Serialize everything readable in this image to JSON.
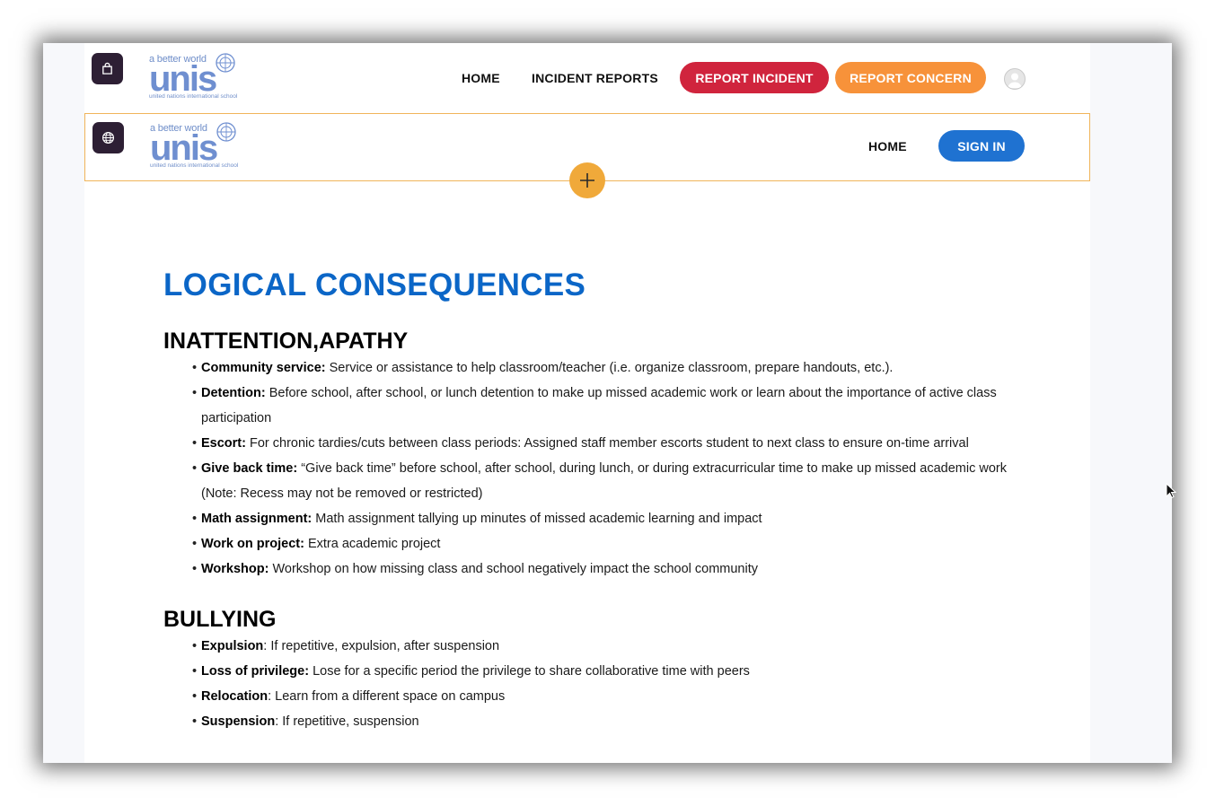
{
  "colors": {
    "accent_blue": "#0b66c7",
    "report_incident": "#d0243d",
    "report_concern": "#f7923a",
    "sign_in": "#1f72d1",
    "add_button": "#f0a93a",
    "header_outline": "#f0b45a",
    "badge_dark": "#2d1f34"
  },
  "private_header": {
    "badge_icon": "shopping-bag-icon",
    "logo": {
      "tagline": "a better world",
      "wordmark": "unis",
      "subtitle": "united nations international school"
    },
    "nav": {
      "home": "HOME",
      "incident_reports": "INCIDENT REPORTS"
    },
    "report_incident": "REPORT INCIDENT",
    "report_concern": "REPORT CONCERN",
    "avatar_icon": "user-avatar-icon"
  },
  "public_header": {
    "badge_icon": "globe-icon",
    "logo": {
      "tagline": "a better world",
      "wordmark": "unis",
      "subtitle": "united nations international school"
    },
    "nav": {
      "home": "HOME"
    },
    "sign_in": "SIGN IN",
    "add_icon": "plus-icon"
  },
  "content": {
    "title": "LOGICAL CONSEQUENCES",
    "sections": [
      {
        "heading": "INATTENTION,APATHY",
        "items": [
          {
            "term": "Community service:",
            "text": " Service or assistance to help classroom/teacher (i.e. organize classroom, prepare handouts, etc.)."
          },
          {
            "term": "Detention:",
            "text": " Before school, after school, or lunch detention to make up missed academic work or learn about the importance of active class participation"
          },
          {
            "term": "Escort:",
            "text": " For chronic tardies/cuts between class periods: Assigned staff member escorts student to next class to ensure on-time arrival"
          },
          {
            "term": "Give back time:",
            "text": " “Give back time” before school, after school, during lunch, or during extracurricular time to make up missed academic work (Note: Recess may not be removed or restricted)"
          },
          {
            "term": "Math assignment:",
            "text": " Math assignment tallying up minutes of missed academic learning and impact"
          },
          {
            "term": "Work on project:",
            "text": " Extra academic project"
          },
          {
            "term": "Workshop:",
            "text": " Workshop on how missing class and school negatively impact the school community"
          }
        ]
      },
      {
        "heading": "BULLYING",
        "items": [
          {
            "term": "Expulsion",
            "text": ": If repetitive, expulsion, after suspension"
          },
          {
            "term": "Loss of privilege:",
            "text": " Lose for a specific period the privilege to share collaborative time with peers"
          },
          {
            "term": "Relocation",
            "text": ": Learn from a different space on campus"
          },
          {
            "term": "Suspension",
            "text": ": If repetitive, suspension"
          }
        ]
      }
    ]
  }
}
